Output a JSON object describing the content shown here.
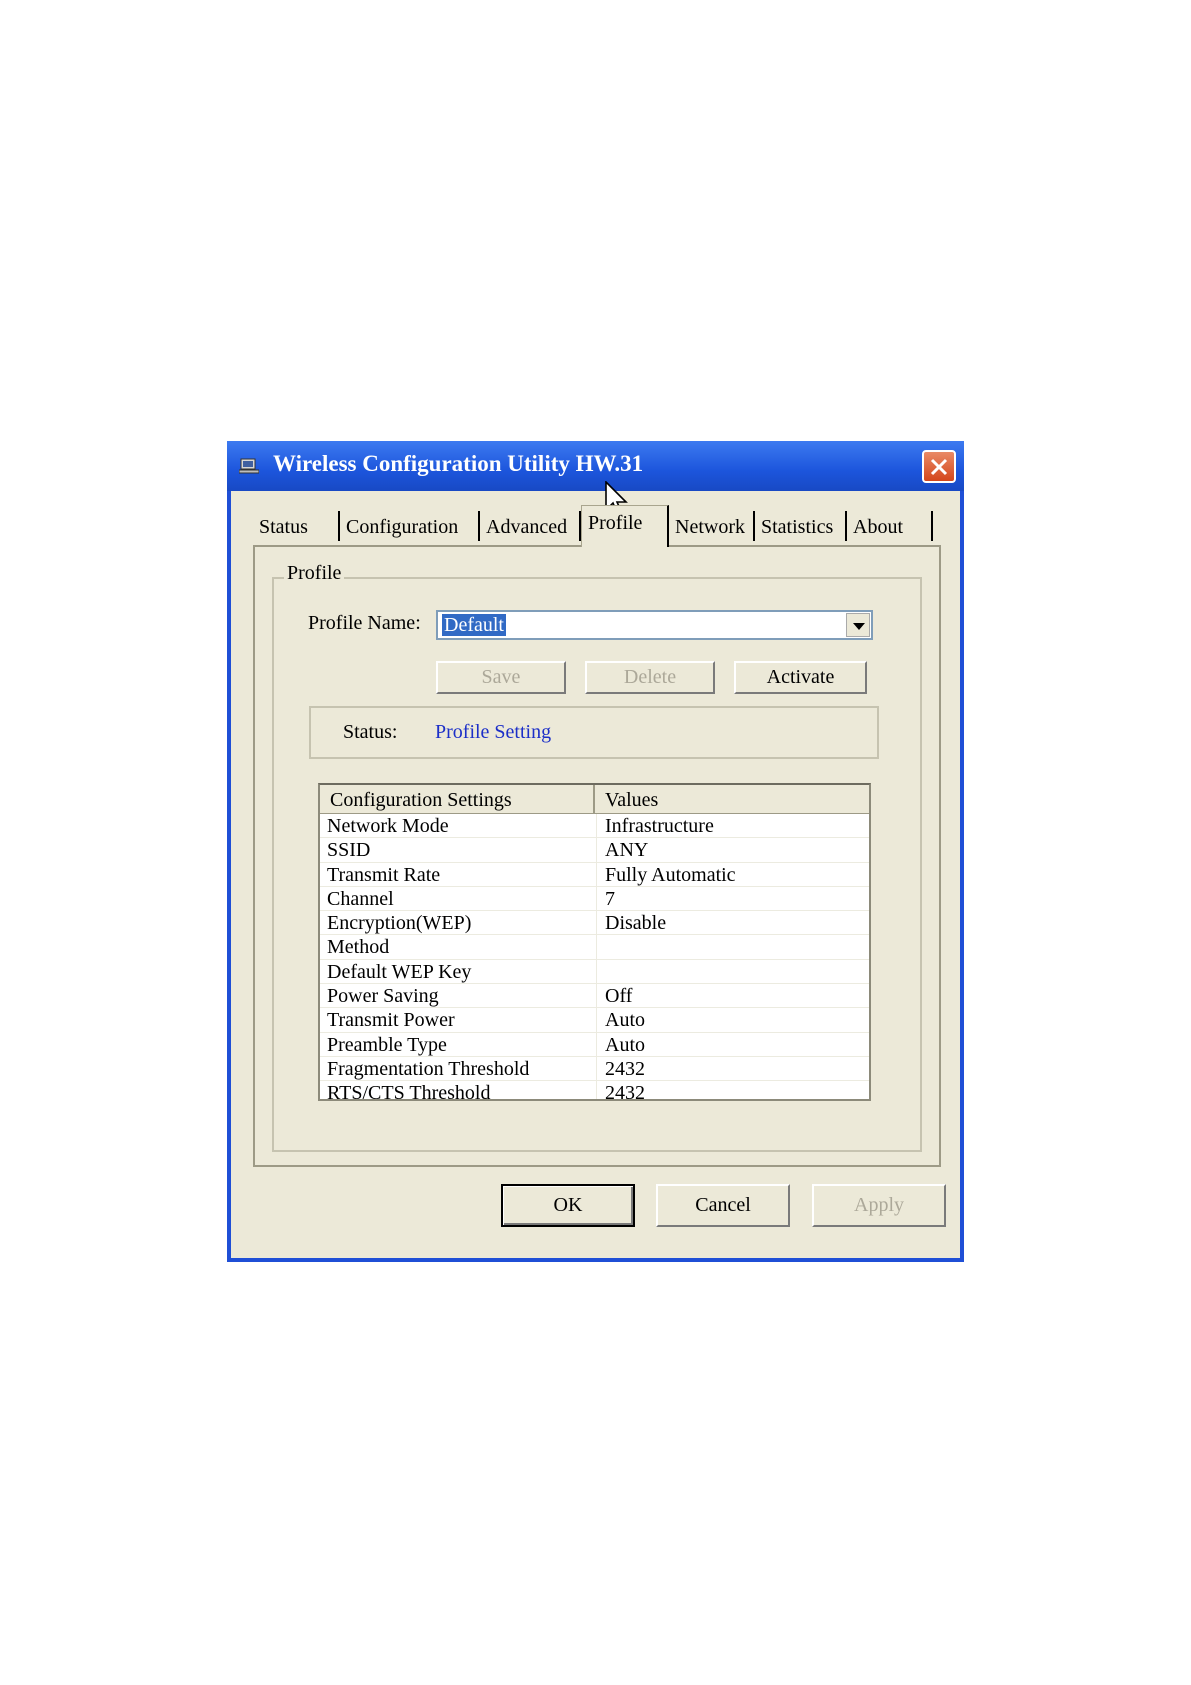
{
  "window": {
    "title": "Wireless Configuration Utility HW.31",
    "icon": "network-computer-icon",
    "close_icon": "close-icon"
  },
  "tabs": [
    {
      "label": "Status"
    },
    {
      "label": "Configuration"
    },
    {
      "label": "Advanced"
    },
    {
      "label": "Profile",
      "active": true
    },
    {
      "label": "Network"
    },
    {
      "label": "Statistics"
    },
    {
      "label": "About"
    }
  ],
  "profile": {
    "group_title": "Profile",
    "name_label": "Profile Name:",
    "name_value": "Default",
    "save_label": "Save",
    "delete_label": "Delete",
    "activate_label": "Activate",
    "status_label": "Status:",
    "status_value": "Profile Setting"
  },
  "table": {
    "headers": [
      "Configuration Settings",
      "Values"
    ],
    "rows": [
      [
        "Network Mode",
        "Infrastructure"
      ],
      [
        "SSID",
        "ANY"
      ],
      [
        "Transmit Rate",
        "Fully Automatic"
      ],
      [
        "Channel",
        "7"
      ],
      [
        "Encryption(WEP)",
        "Disable"
      ],
      [
        "Method",
        ""
      ],
      [
        "Default WEP Key",
        ""
      ],
      [
        "Power Saving",
        "Off"
      ],
      [
        "Transmit Power",
        "Auto"
      ],
      [
        "Preamble Type",
        "Auto"
      ],
      [
        "Fragmentation Threshold",
        "2432"
      ],
      [
        "RTS/CTS Threshold",
        "2432"
      ]
    ]
  },
  "footer": {
    "ok_label": "OK",
    "cancel_label": "Cancel",
    "apply_label": "Apply"
  },
  "colors": {
    "titlebar": "#1f4fd6",
    "dialog_bg": "#ece9d8",
    "status_link": "#1c2fc8",
    "selection": "#316ac5"
  }
}
